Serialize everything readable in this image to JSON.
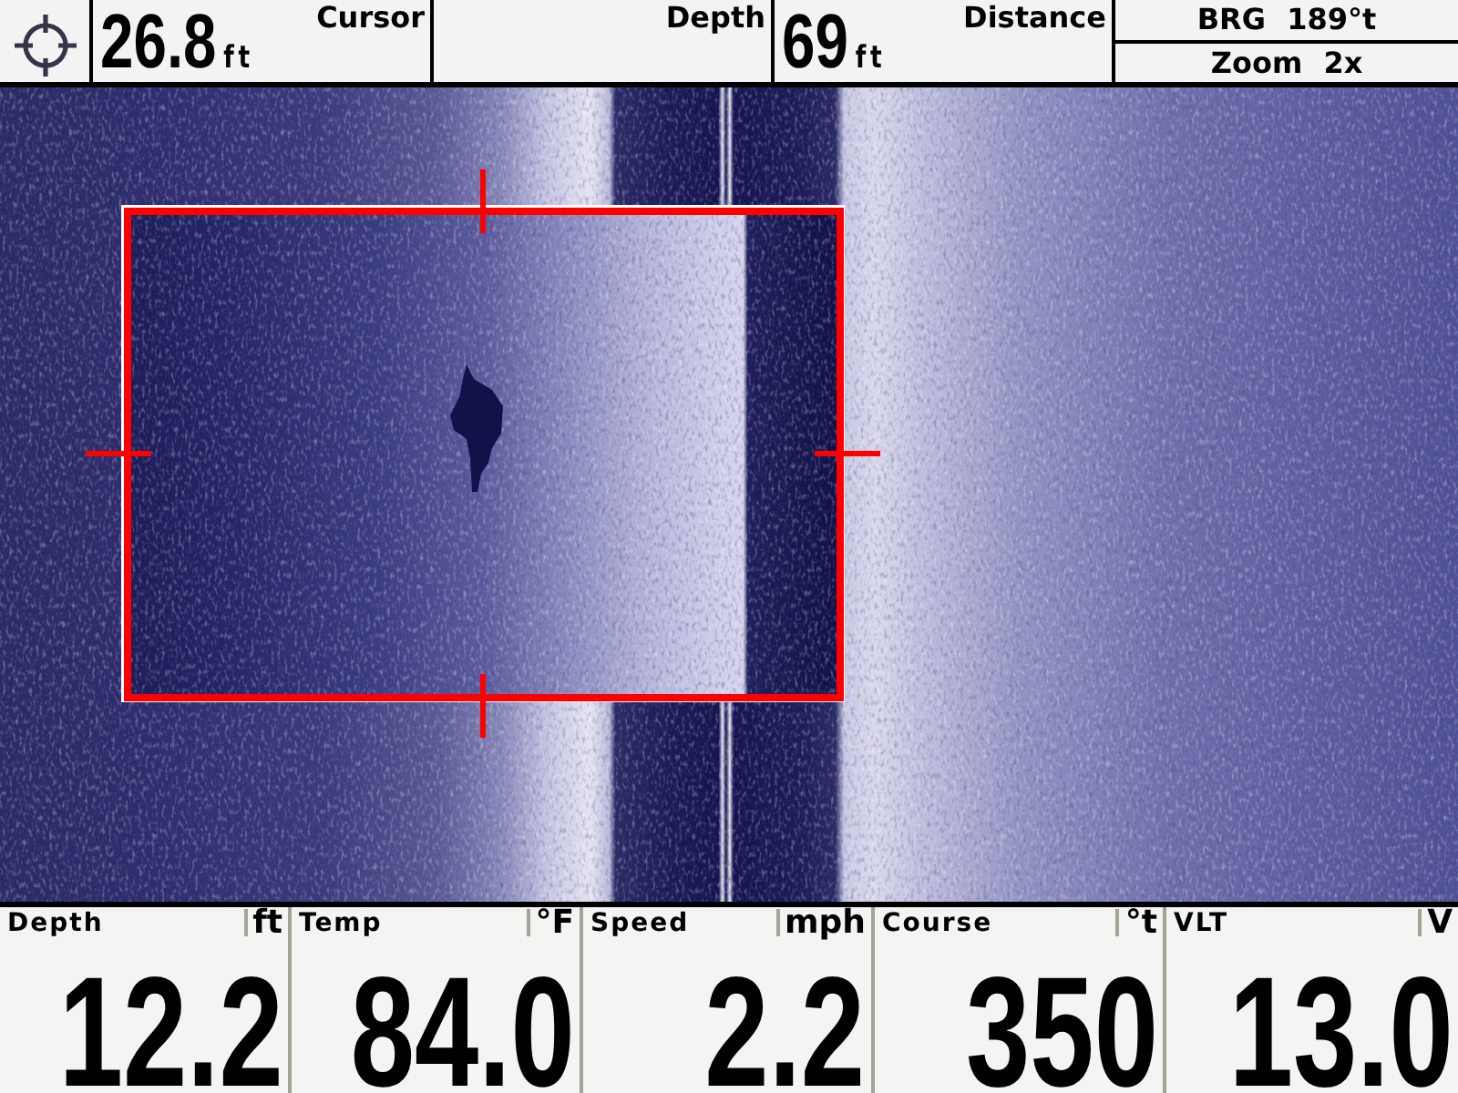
{
  "top_bar": {
    "cells": [
      {
        "parts": [
          {
            "value": "26.8",
            "unit": "ft"
          },
          {
            "label": "Cursor"
          }
        ]
      },
      {
        "parts": [
          {
            "label": "Depth"
          }
        ]
      },
      {
        "parts": [
          {
            "value": "69",
            "unit": "ft"
          },
          {
            "label": "Distance"
          }
        ]
      }
    ],
    "info": [
      "BRG 189°t",
      "Zoom 2x"
    ]
  },
  "readouts": [
    {
      "label": "Depth",
      "unit": "ft",
      "value": "12.2"
    },
    {
      "label": "Temp",
      "unit": "°F",
      "value": "84.0"
    },
    {
      "label": "Speed",
      "unit": "mph",
      "value": "2.2"
    },
    {
      "label": "Course",
      "unit": "°t",
      "value": "350"
    },
    {
      "label": "VLT",
      "unit": "V",
      "value": "13.0"
    }
  ]
}
